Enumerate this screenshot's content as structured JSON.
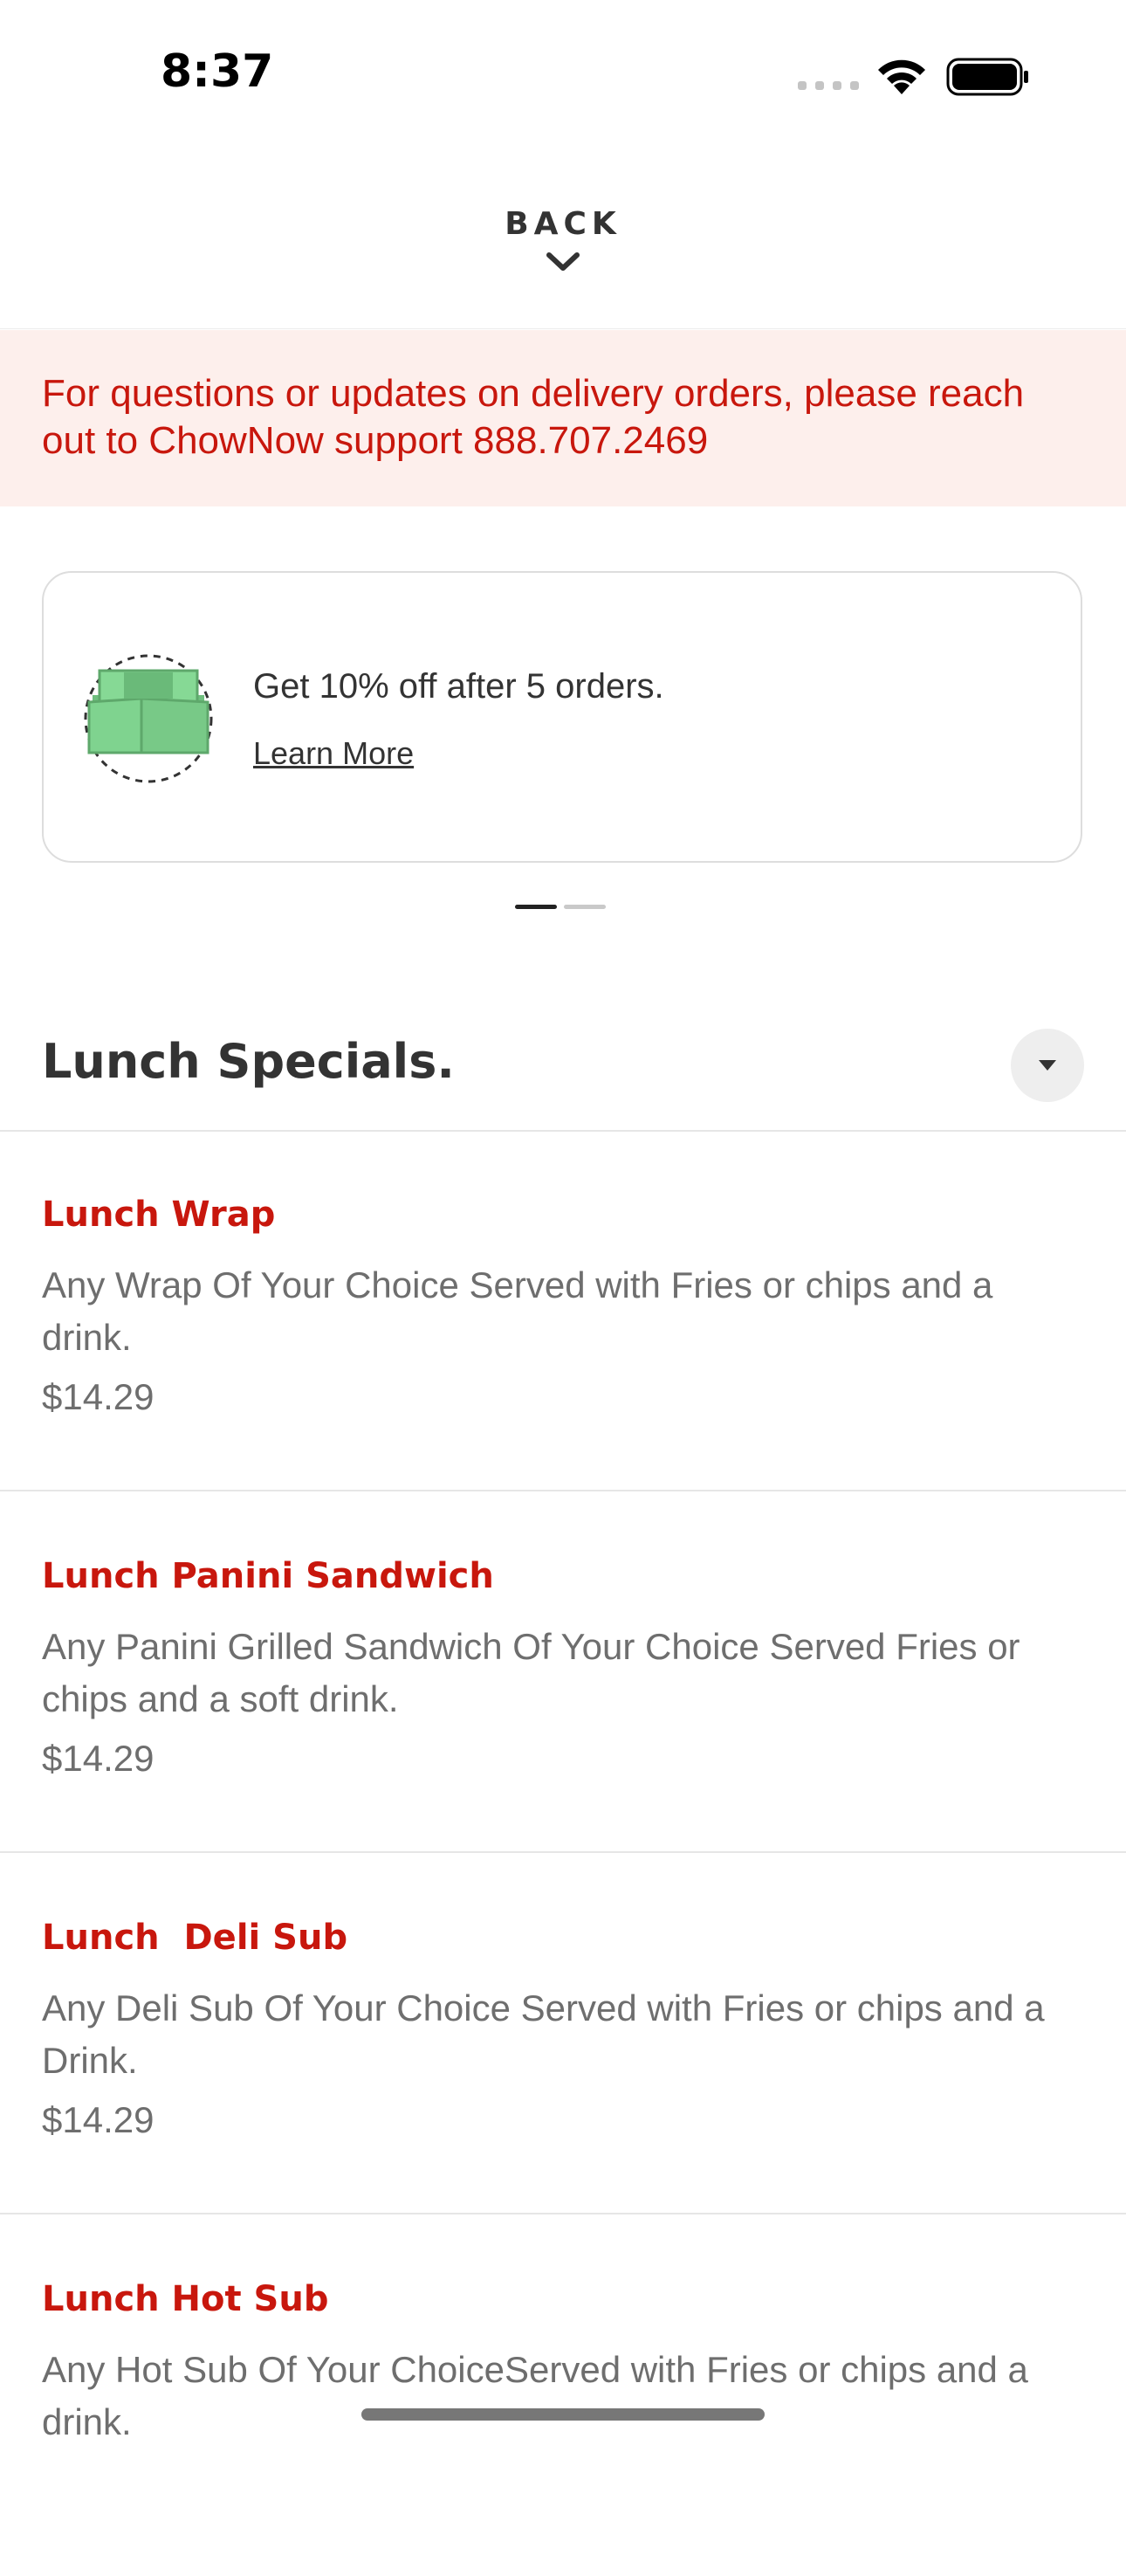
{
  "status_bar": {
    "time": "8:37"
  },
  "nav": {
    "back_label": "BACK"
  },
  "notice": {
    "text": "For questions or updates on delivery orders, please reach out to ChowNow support 888.707.2469"
  },
  "promo": {
    "title": "Get 10% off after 5 orders.",
    "link_label": "Learn More",
    "page_count": 2,
    "active_page": 1
  },
  "section": {
    "title": "Lunch Specials."
  },
  "menu_items": [
    {
      "name": "Lunch Wrap",
      "description": "Any Wrap Of Your Choice Served with Fries or chips and a drink.",
      "price": "$14.29"
    },
    {
      "name": "Lunch Panini Sandwich",
      "description": "Any Panini Grilled Sandwich Of Your Choice Served Fries or chips and a soft drink.",
      "price": "$14.29"
    },
    {
      "name": "Lunch  Deli Sub",
      "description": "Any Deli Sub Of Your Choice Served with Fries or chips and a Drink.",
      "price": "$14.29"
    },
    {
      "name": "Lunch Hot Sub",
      "description": "Any Hot Sub Of Your ChoiceServed with Fries or chips and a drink.",
      "price": ""
    }
  ],
  "colors": {
    "accent": "#c8170d",
    "notice_bg": "#fdefec",
    "gift_green": "#7fd38f"
  }
}
